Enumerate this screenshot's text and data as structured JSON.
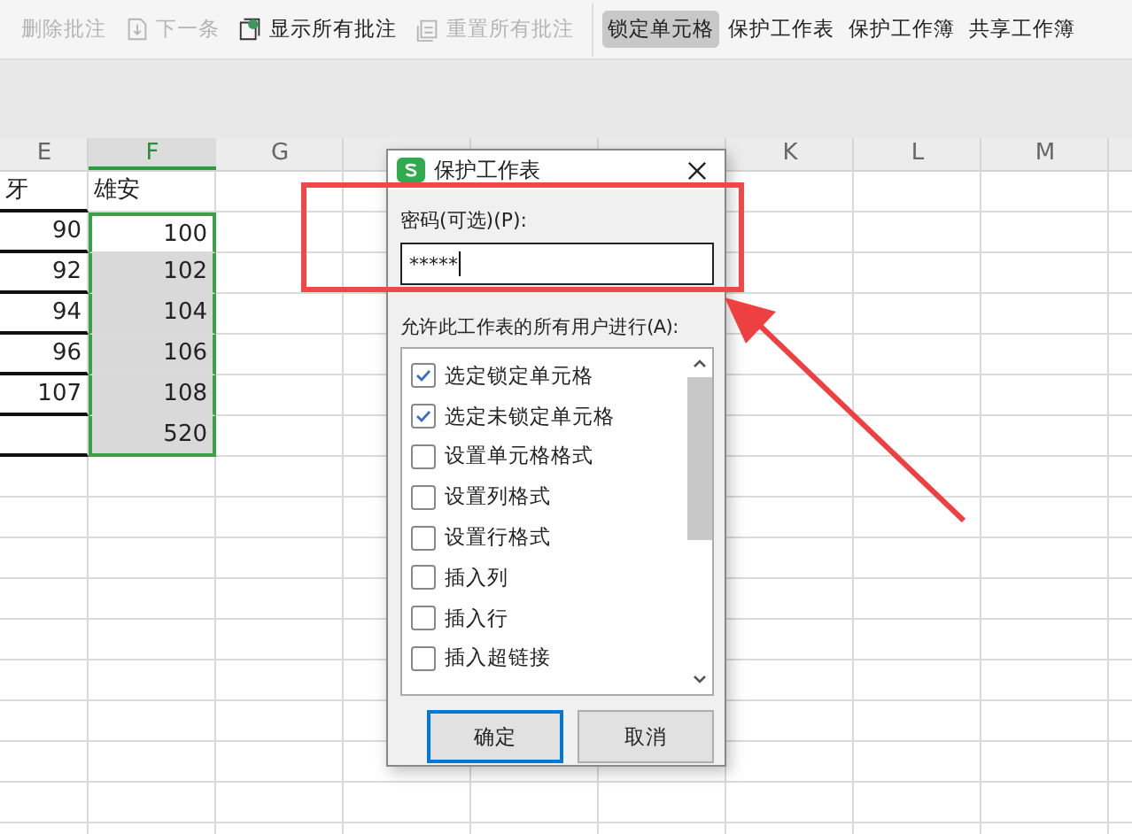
{
  "toolbar": {
    "comment_tools": [
      {
        "label": "删除批注",
        "disabled": true
      },
      {
        "label": "下一条",
        "disabled": true
      },
      {
        "label": "显示所有批注",
        "disabled": false
      },
      {
        "label": "重置所有批注",
        "disabled": true
      }
    ],
    "protect_tools": [
      {
        "label": "锁定单元格",
        "selected": true
      },
      {
        "label": "保护工作表",
        "selected": false
      },
      {
        "label": "保护工作簿",
        "selected": false
      },
      {
        "label": "共享工作簿",
        "selected": false
      }
    ]
  },
  "sheet": {
    "columns": [
      {
        "label": "E",
        "selected": false
      },
      {
        "label": "F",
        "selected": true
      },
      {
        "label": "G",
        "selected": false
      },
      {
        "label": "K",
        "selected": false
      },
      {
        "label": "L",
        "selected": false
      },
      {
        "label": "M",
        "selected": false
      }
    ],
    "rows": [
      {
        "column_e": "牙",
        "column_f": "雄安",
        "selected": false,
        "kind": "header"
      },
      {
        "column_e": "90",
        "column_f": "100",
        "selected": false,
        "kind": "number"
      },
      {
        "column_e": "92",
        "column_f": "102",
        "selected": true,
        "kind": "number"
      },
      {
        "column_e": "94",
        "column_f": "104",
        "selected": true,
        "kind": "number"
      },
      {
        "column_e": "96",
        "column_f": "106",
        "selected": true,
        "kind": "number"
      },
      {
        "column_e": "107",
        "column_f": "108",
        "selected": true,
        "kind": "number"
      },
      {
        "column_f": "520",
        "selected": true,
        "kind": "number"
      }
    ]
  },
  "dialog": {
    "title": "保护工作表",
    "password_label": "密码(可选)(P):",
    "password_value": "*****",
    "permissions_label": "允许此工作表的所有用户进行(A):",
    "permissions": [
      {
        "label": "选定锁定单元格",
        "checked": true
      },
      {
        "label": "选定未锁定单元格",
        "checked": true
      },
      {
        "label": "设置单元格格式",
        "checked": false
      },
      {
        "label": "设置列格式",
        "checked": false
      },
      {
        "label": "设置行格式",
        "checked": false
      },
      {
        "label": "插入列",
        "checked": false
      },
      {
        "label": "插入行",
        "checked": false
      },
      {
        "label": "插入超链接",
        "checked": false
      }
    ],
    "buttons": [
      {
        "label": "确定",
        "default": true
      },
      {
        "label": "取消",
        "default": false
      }
    ]
  }
}
